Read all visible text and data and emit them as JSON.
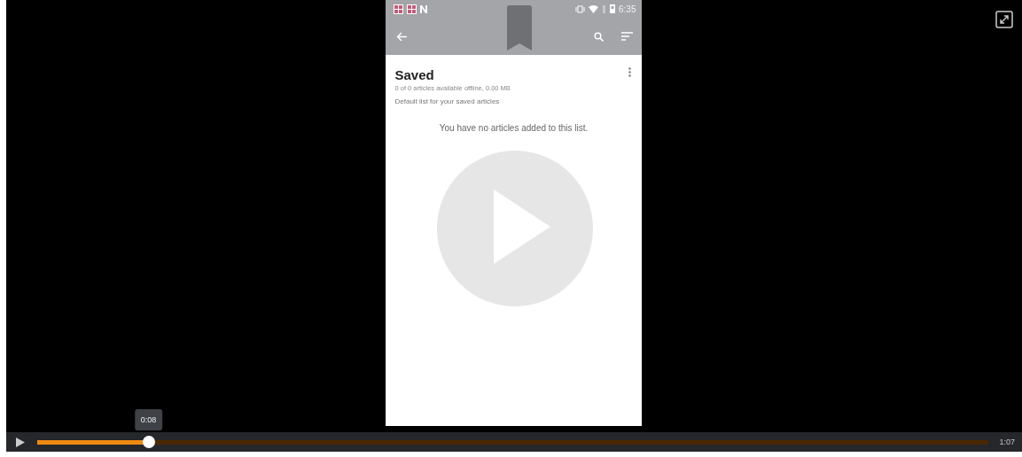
{
  "phone": {
    "status_time": "6:35",
    "list_title": "Saved",
    "list_subtitle": "0 of 0 articles available offline, 0.00 MB",
    "list_description": "Default list for your saved articles",
    "empty_message": "You have no articles added to this list."
  },
  "player": {
    "playing": false,
    "level": 0.117,
    "hover_time": "0:08",
    "duration": "1:07"
  }
}
